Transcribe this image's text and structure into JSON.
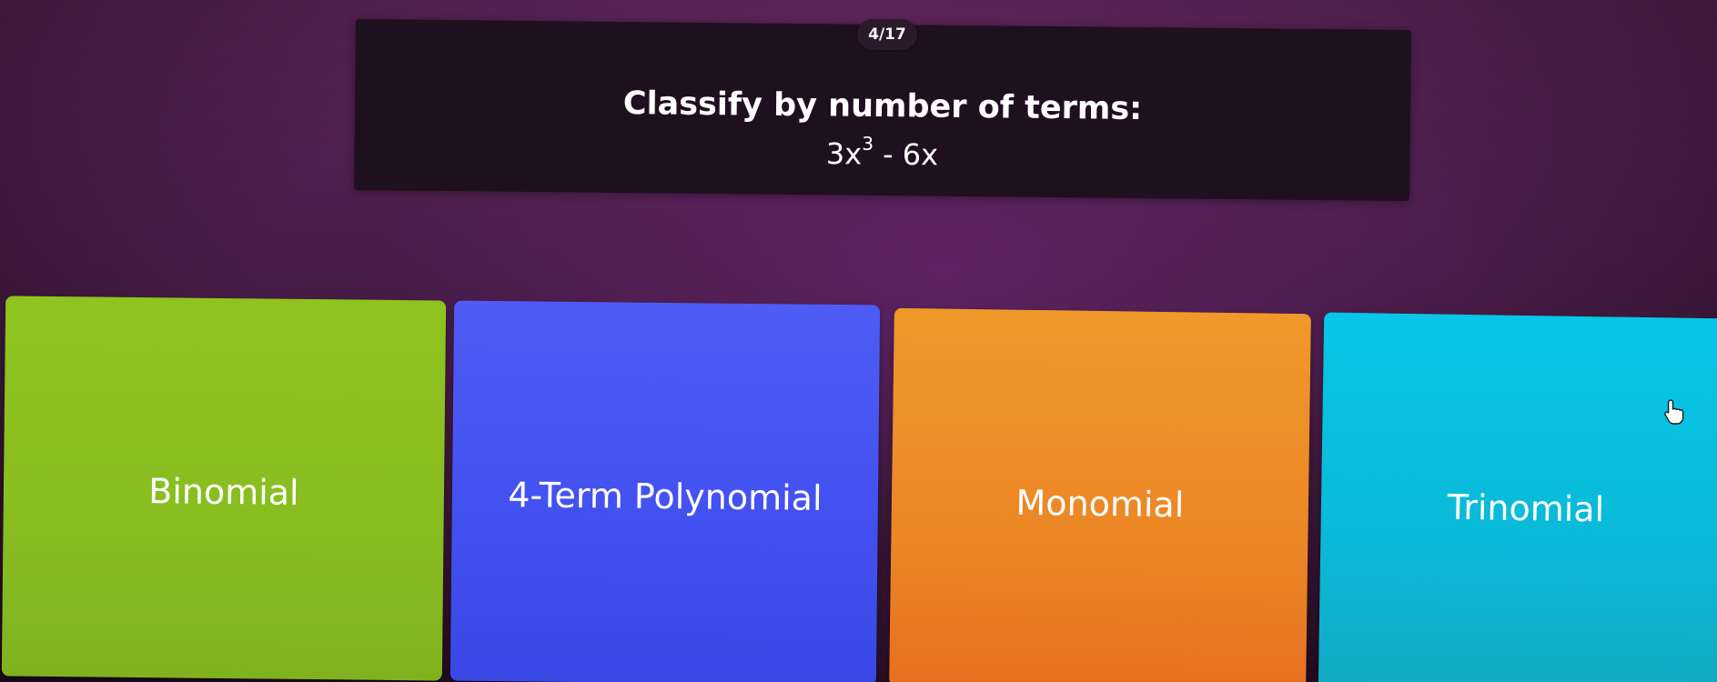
{
  "progress": {
    "label": "4/17"
  },
  "question": {
    "prompt": "Classify by number of terms:",
    "expression": {
      "coef1": "3x",
      "exp1": "3",
      "rest": " - 6x"
    }
  },
  "options": [
    {
      "label": "Binomial",
      "color": "#8fc31e"
    },
    {
      "label": "4-Term Polynomial",
      "color": "#4e5cf5"
    },
    {
      "label": "Monomial",
      "color": "#ec8626"
    },
    {
      "label": "Trinomial",
      "color": "#07c6e8"
    }
  ],
  "cursor": {
    "icon": "hand-pointer-icon"
  }
}
